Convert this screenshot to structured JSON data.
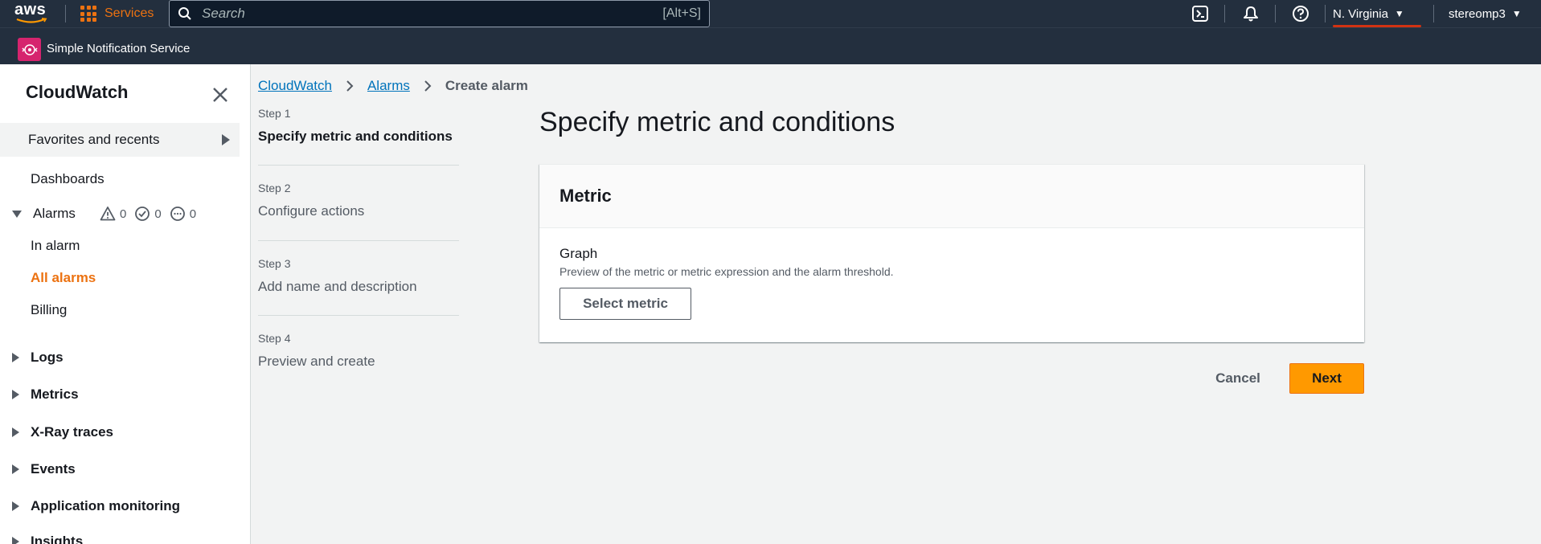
{
  "topnav": {
    "logo_text": "aws",
    "services_label": "Services",
    "search_placeholder": "Search",
    "search_shortcut": "[Alt+S]",
    "region": "N. Virginia",
    "account": "stereomp3",
    "icons": [
      "cloudshell-icon",
      "bell-icon",
      "help-icon"
    ]
  },
  "subnav": {
    "favorite_service": "Simple Notification Service"
  },
  "sidebar": {
    "title": "CloudWatch",
    "favorites": "Favorites and recents",
    "dashboards": "Dashboards",
    "alarms": "Alarms",
    "alarm_counts": {
      "in_alarm": "0",
      "ok": "0",
      "insufficient": "0"
    },
    "in_alarm": "In alarm",
    "all_alarms": "All alarms",
    "billing": "Billing",
    "sections": [
      "Logs",
      "Metrics",
      "X-Ray traces",
      "Events",
      "Application monitoring",
      "Insights"
    ]
  },
  "breadcrumb": {
    "items": [
      "CloudWatch",
      "Alarms"
    ],
    "current": "Create alarm"
  },
  "steps": [
    {
      "num": "Step 1",
      "title": "Specify metric and conditions"
    },
    {
      "num": "Step 2",
      "title": "Configure actions"
    },
    {
      "num": "Step 3",
      "title": "Add name and description"
    },
    {
      "num": "Step 4",
      "title": "Preview and create"
    }
  ],
  "main": {
    "title": "Specify metric and conditions",
    "card_title": "Metric",
    "graph_label": "Graph",
    "graph_desc": "Preview of the metric or metric expression and the alarm threshold.",
    "select_metric": "Select metric",
    "cancel": "Cancel",
    "next": "Next"
  },
  "colors": {
    "nav_bg": "#232f3e",
    "accent_orange": "#ec7211",
    "primary_button": "#ff9900",
    "link_blue": "#0073bb",
    "sns_tile": "#d6246e",
    "region_underline": "#d13212"
  }
}
